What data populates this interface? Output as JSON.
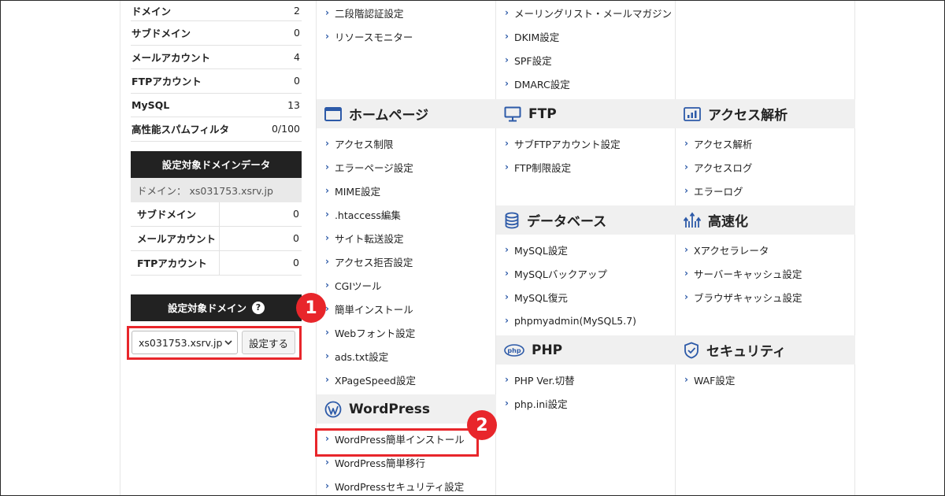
{
  "sidebar": {
    "stats": [
      {
        "label": "ドメイン",
        "value": "2"
      },
      {
        "label": "サブドメイン",
        "value": "0"
      },
      {
        "label": "メールアカウント",
        "value": "4"
      },
      {
        "label": "FTPアカウント",
        "value": "0"
      },
      {
        "label": "MySQL",
        "value": "13"
      },
      {
        "label": "高性能スパムフィルタ",
        "value": "0/100"
      }
    ],
    "domain_data_title": "設定対象ドメインデータ",
    "domain_line": "ドメイン： xs031753.xsrv.jp",
    "domain_rows": [
      {
        "label": "サブドメイン",
        "value": "0"
      },
      {
        "label": "メールアカウント",
        "value": "0"
      },
      {
        "label": "FTPアカウント",
        "value": "0"
      }
    ],
    "select_title": "設定対象ドメイン",
    "help_glyph": "?",
    "selected_domain": "xs031753.xsrv.jp",
    "set_button": "設定する"
  },
  "badges": {
    "one": "1",
    "two": "2"
  },
  "col1": {
    "top_links": [
      "二段階認証設定",
      "リソースモニター"
    ],
    "homepage_title": "ホームページ",
    "homepage_links": [
      "アクセス制限",
      "エラーページ設定",
      "MIME設定",
      ".htaccess編集",
      "サイト転送設定",
      "アクセス拒否設定",
      "CGIツール",
      "簡単インストール",
      "Webフォント設定",
      "ads.txt設定",
      "XPageSpeed設定"
    ],
    "wordpress_title": "WordPress",
    "wordpress_links": [
      "WordPress簡単インストール",
      "WordPress簡単移行",
      "WordPressセキュリティ設定"
    ]
  },
  "col2": {
    "top_links": [
      "メーリングリスト・メールマガジン",
      "DKIM設定",
      "SPF設定",
      "DMARC設定"
    ],
    "ftp_title": "FTP",
    "ftp_links": [
      "サブFTPアカウント設定",
      "FTP制限設定"
    ],
    "db_title": "データベース",
    "db_links": [
      "MySQL設定",
      "MySQLバックアップ",
      "MySQL復元",
      "phpmyadmin(MySQL5.7)"
    ],
    "php_title": "PHP",
    "php_links": [
      "PHP Ver.切替",
      "php.ini設定"
    ]
  },
  "col3": {
    "access_title": "アクセス解析",
    "access_links": [
      "アクセス解析",
      "アクセスログ",
      "エラーログ"
    ],
    "speed_title": "高速化",
    "speed_links": [
      "Xアクセラレータ",
      "サーバーキャッシュ設定",
      "ブラウザキャッシュ設定"
    ],
    "security_title": "セキュリティ",
    "security_links": [
      "WAF設定"
    ]
  },
  "colors": {
    "accent_red": "#e8262b",
    "link_arrow": "#2d5aa8",
    "header_dark": "#222222",
    "section_bg": "#f0f0f0"
  }
}
